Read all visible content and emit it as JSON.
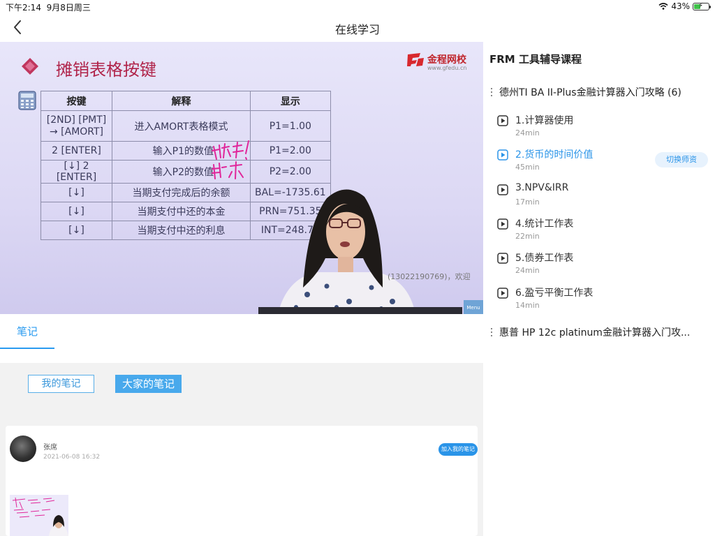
{
  "status_bar": {
    "time": "下午2:14",
    "date": "9月8日周三",
    "battery": "43%",
    "battery_level": 0.43
  },
  "nav": {
    "title": "在线学习"
  },
  "video": {
    "slide_title": "摊销表格按键",
    "brand": "金程网校",
    "brand_sub": "www.gfedu.cn",
    "table": {
      "headers": [
        "按键",
        "解释",
        "显示"
      ],
      "rows": [
        [
          "[2ND] [PMT]\n→ [AMORT]",
          "进入AMORT表格模式",
          "P1=1.00"
        ],
        [
          "2 [ENTER]",
          "输入P1的数值",
          "P1=2.00"
        ],
        [
          "[↓] 2 [ENTER]",
          "输入P2的数值",
          "P2=2.00"
        ],
        [
          "[↓]",
          "当期支付完成后的余额",
          "BAL=-1735.61"
        ],
        [
          "[↓]",
          "当期支付中还的本金",
          "PRN=751.35"
        ],
        [
          "[↓]",
          "当期支付中还的利息",
          "INT=248.70"
        ]
      ]
    },
    "overlay_text": "(13022190769)，欢迎",
    "menu_label": "Menu"
  },
  "notes": {
    "tab_label": "笔记",
    "my_notes_label": "我的笔记",
    "all_notes_label": "大家的笔记",
    "note": {
      "author": "张席",
      "time": "2021-06-08 16:32",
      "add_label": "加入我的笔记"
    }
  },
  "course": {
    "title": "FRM 工具辅导课程",
    "chapters": [
      {
        "title": "德州TI BA II-Plus金融计算器入门攻略 (6)"
      },
      {
        "title": "惠普 HP 12c platinum金融计算器入门攻..."
      }
    ],
    "lessons": [
      {
        "title": "1.计算器使用",
        "duration": "24min"
      },
      {
        "title": "2.货币的时间价值",
        "duration": "45min"
      },
      {
        "title": "3.NPV&IRR",
        "duration": "17min"
      },
      {
        "title": "4.统计工作表",
        "duration": "22min"
      },
      {
        "title": "5.债券工作表",
        "duration": "24min"
      },
      {
        "title": "6.盈亏平衡工作表",
        "duration": "14min"
      }
    ],
    "switch_teacher_label": "切换师资"
  },
  "colors": {
    "accent": "#2a94e8",
    "slide_title": "#b0244a",
    "brand": "#c0262d"
  }
}
